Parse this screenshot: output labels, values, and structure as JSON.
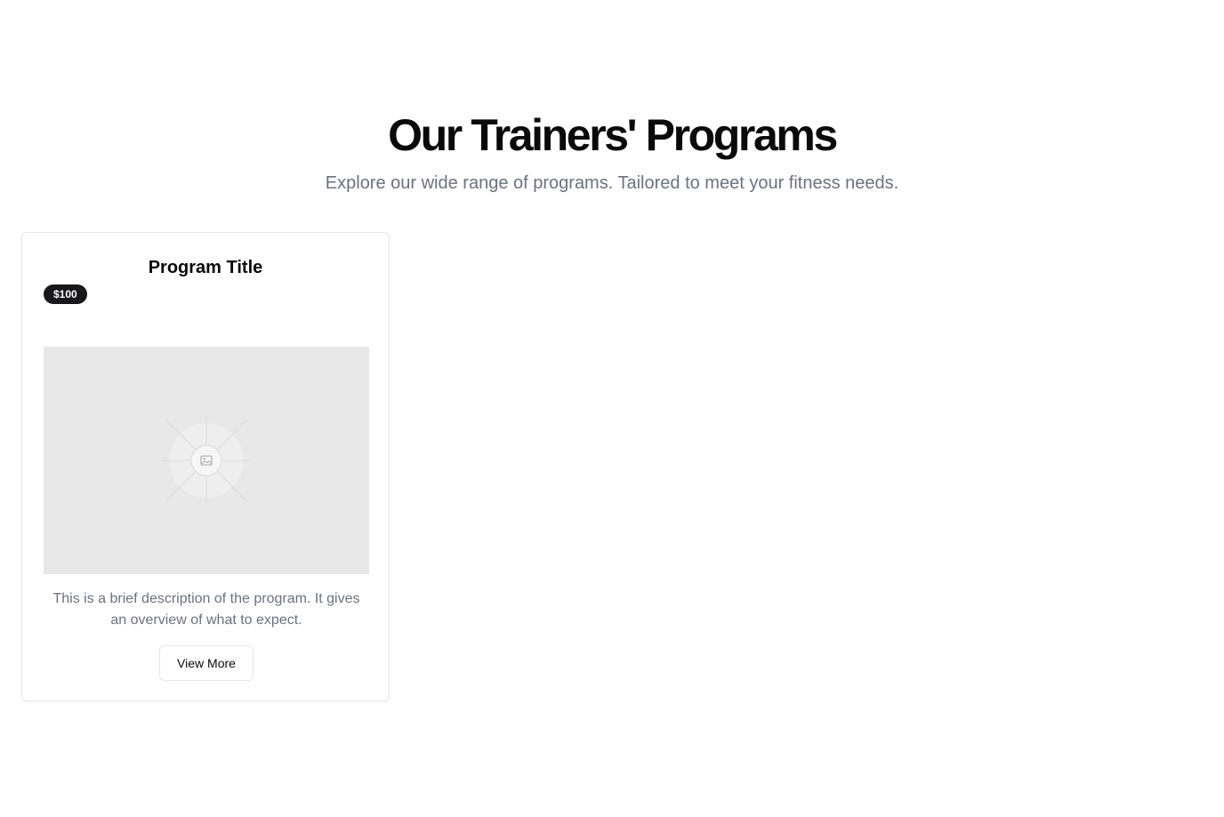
{
  "section": {
    "title": "Our Trainers' Programs",
    "subtitle": "Explore our wide range of programs. Tailored to meet your fitness needs."
  },
  "programs": [
    {
      "title": "Program Title",
      "price": "$100",
      "image_icon": "image-placeholder-icon",
      "description": "This is a brief description of the program. It gives an overview of what to expect.",
      "button_label": "View More"
    }
  ],
  "colors": {
    "badge_background": "#18181b",
    "subtitle_text": "#6b7280",
    "image_placeholder": "#e8e8e8",
    "card_border": "#e5e7eb"
  }
}
